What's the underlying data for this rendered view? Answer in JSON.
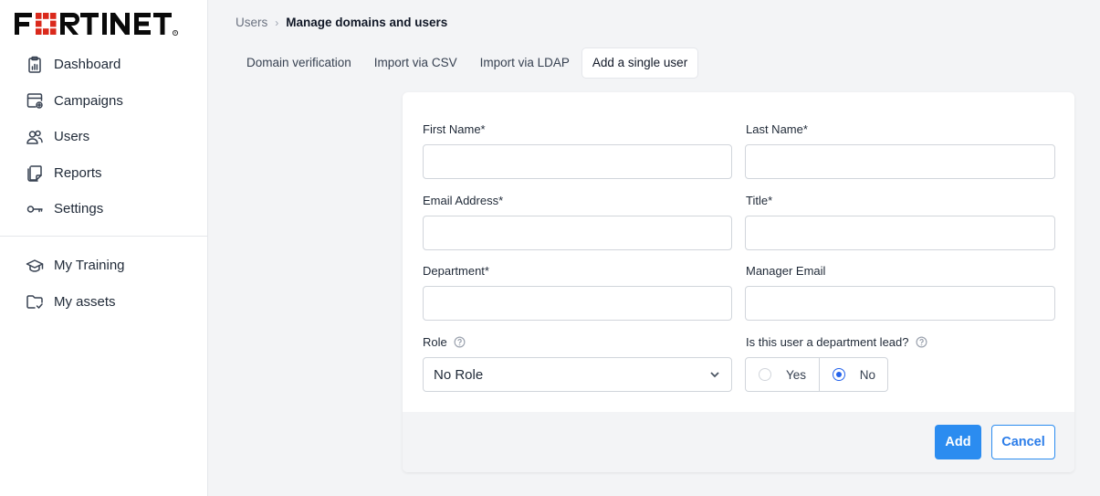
{
  "brand": {
    "name": "FORTINET",
    "color": "#da291c"
  },
  "sidebar": {
    "items": [
      {
        "label": "Dashboard",
        "icon": "clipboard-chart-icon"
      },
      {
        "label": "Campaigns",
        "icon": "browser-plus-icon"
      },
      {
        "label": "Users",
        "icon": "users-icon"
      },
      {
        "label": "Reports",
        "icon": "document-icon"
      },
      {
        "label": "Settings",
        "icon": "key-icon"
      }
    ],
    "secondary": [
      {
        "label": "My Training",
        "icon": "graduation-cap-icon"
      },
      {
        "label": "My assets",
        "icon": "folder-check-icon"
      }
    ]
  },
  "breadcrumb": {
    "parent": "Users",
    "separator": "›",
    "current": "Manage domains and users"
  },
  "tabs": [
    {
      "label": "Domain verification",
      "active": false
    },
    {
      "label": "Import via CSV",
      "active": false
    },
    {
      "label": "Import via LDAP",
      "active": false
    },
    {
      "label": "Add a single user",
      "active": true
    }
  ],
  "form": {
    "first_name": {
      "label": "First Name*",
      "value": ""
    },
    "last_name": {
      "label": "Last Name*",
      "value": ""
    },
    "email": {
      "label": "Email Address*",
      "value": ""
    },
    "title": {
      "label": "Title*",
      "value": ""
    },
    "department": {
      "label": "Department*",
      "value": ""
    },
    "manager_email": {
      "label": "Manager Email",
      "value": ""
    },
    "role": {
      "label": "Role",
      "selected": "No Role"
    },
    "dept_lead": {
      "label": "Is this user a department lead?",
      "yes": "Yes",
      "no": "No",
      "selected": "No"
    }
  },
  "actions": {
    "add": "Add",
    "cancel": "Cancel"
  },
  "colors": {
    "primary": "#2b8cf0",
    "radio_checked": "#2563eb",
    "background": "#f3f4f6"
  }
}
